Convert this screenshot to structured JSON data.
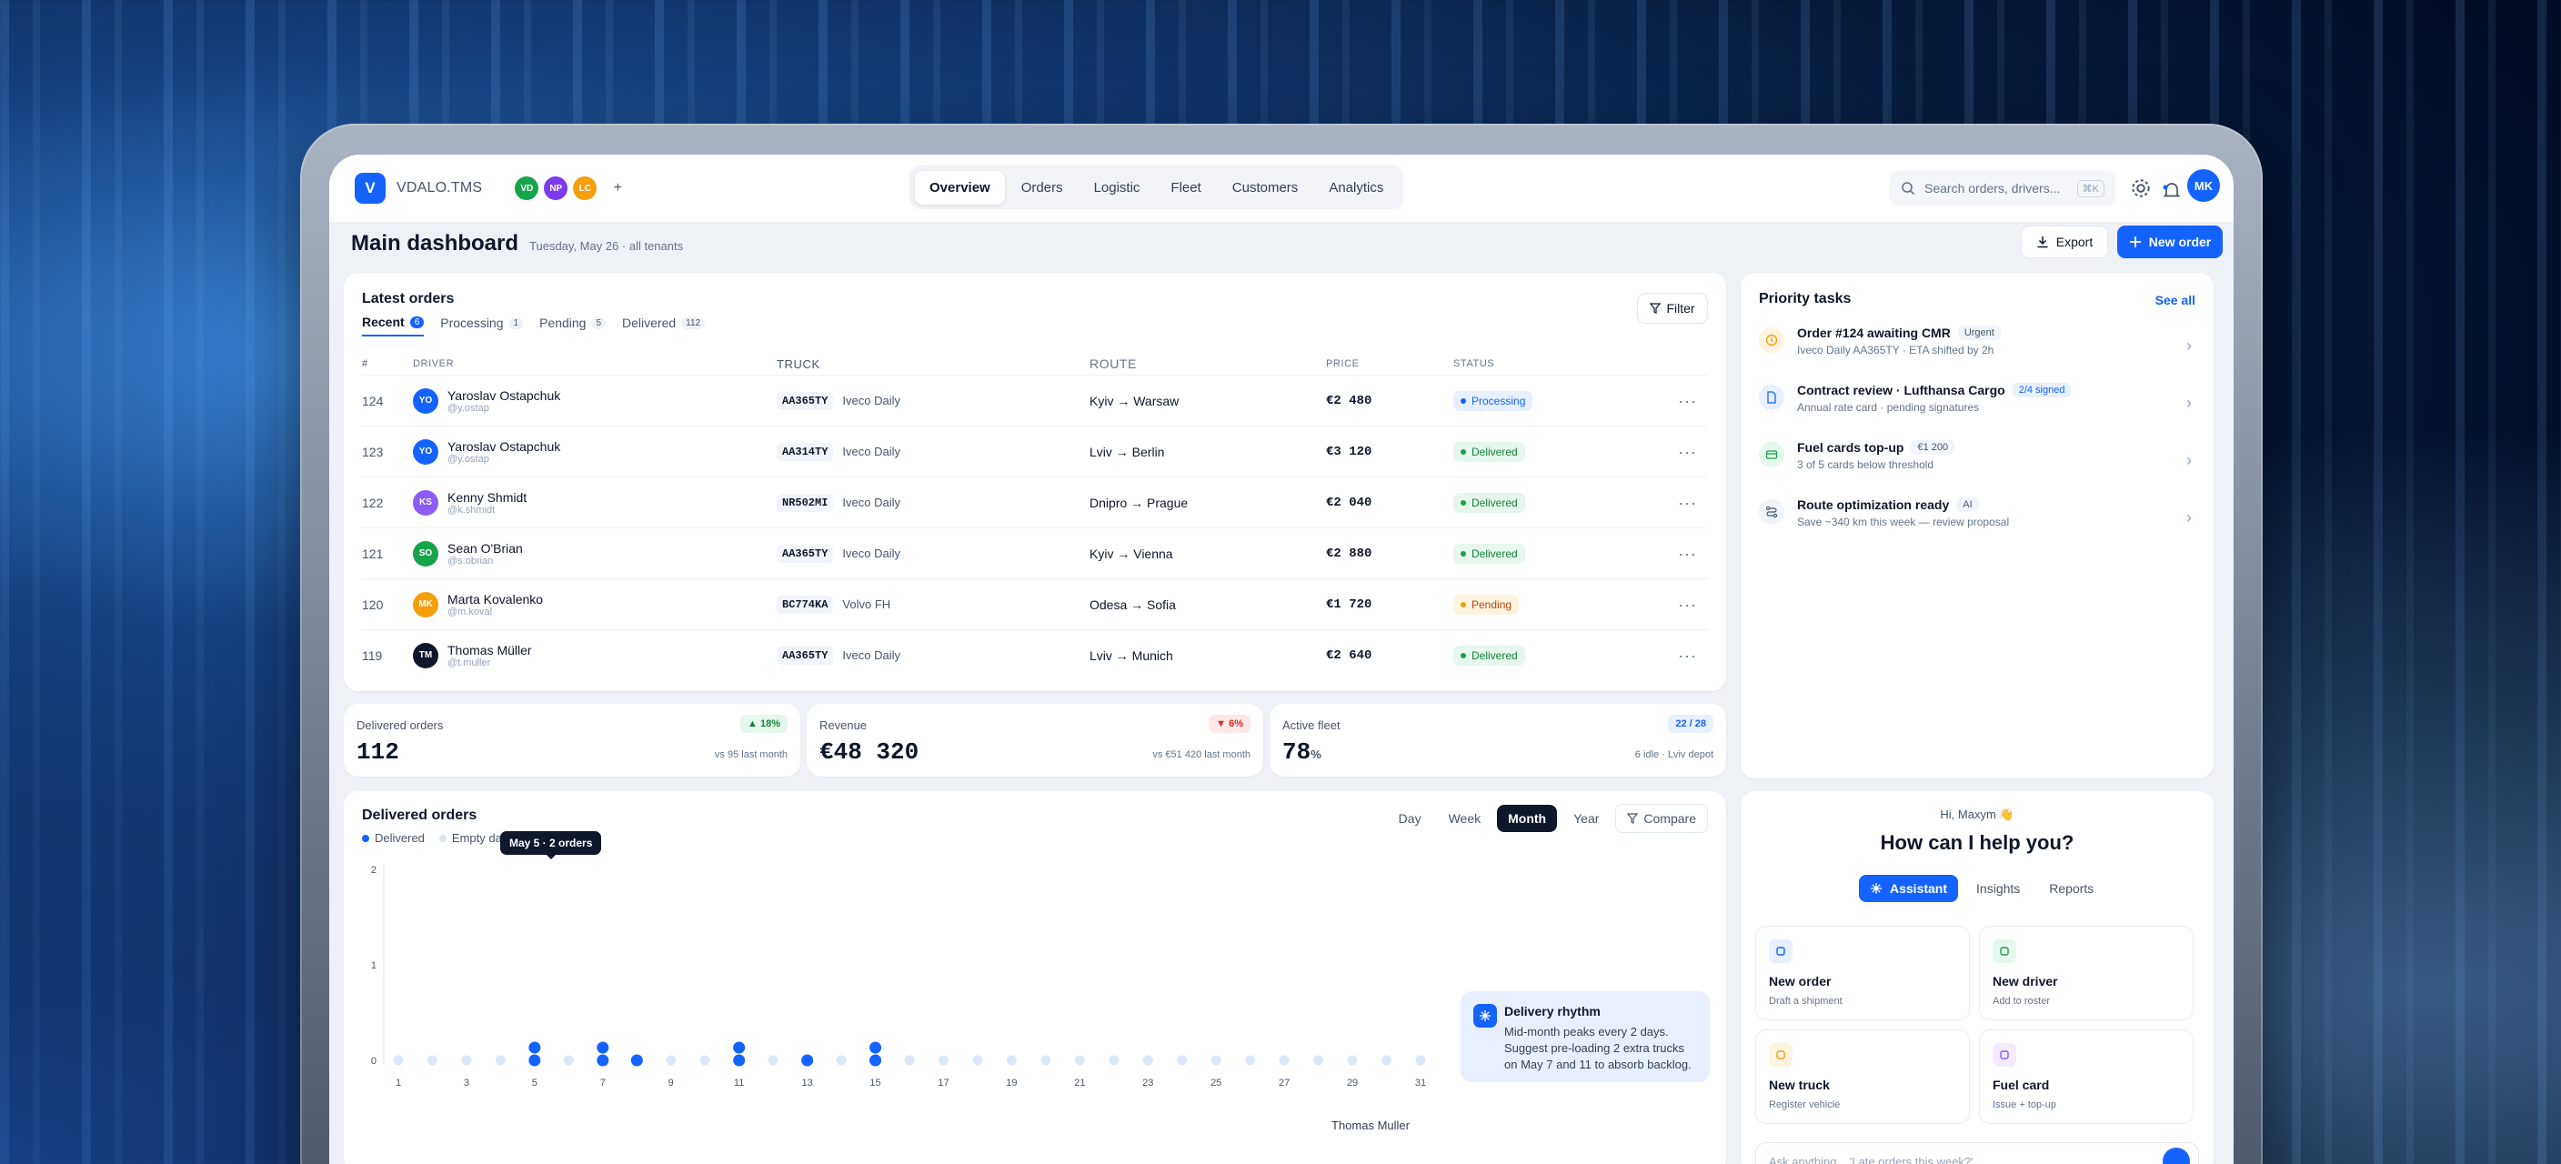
{
  "app": {
    "logo_letter": "V",
    "name": "VDALO.TMS"
  },
  "tenants": [
    {
      "initials": "VD",
      "color": "#16a34a"
    },
    {
      "initials": "NP",
      "color": "#7c3aed"
    },
    {
      "initials": "LC",
      "color": "#f59e0b"
    }
  ],
  "tenant_add": "+",
  "nav": [
    "Overview",
    "Orders",
    "Logistic",
    "Fleet",
    "Customers",
    "Analytics"
  ],
  "nav_active": "Overview",
  "search": {
    "placeholder": "Search orders, drivers...",
    "shortcut": "⌘K"
  },
  "user": {
    "initials": "MK"
  },
  "page": {
    "title": "Main dashboard",
    "subtitle": "Tuesday, May 26 · all tenants"
  },
  "actions": {
    "export": "Export",
    "new_order": "New order"
  },
  "orders": {
    "title": "Latest orders",
    "tabs": [
      {
        "label": "Recent",
        "count": "6"
      },
      {
        "label": "Processing",
        "count": "1"
      },
      {
        "label": "Pending",
        "count": "5"
      },
      {
        "label": "Delivered",
        "count": "112"
      }
    ],
    "filter": "Filter",
    "columns": [
      "#",
      "DRIVER",
      "TRUCK",
      "ROUTE",
      "PRICE",
      "STATUS"
    ],
    "rows": [
      {
        "id": "124",
        "driver": "Yaroslav Ostapchuk",
        "handle": "@y.ostap",
        "initials": "YO",
        "avatar_color": "#1463ff",
        "plate": "AA365TY",
        "truck": "Iveco Daily",
        "route": "Kyiv → Warsaw",
        "price": "€2 480",
        "status": "Processing"
      },
      {
        "id": "123",
        "driver": "Yaroslav Ostapchuk",
        "handle": "@y.ostap",
        "initials": "YO",
        "avatar_color": "#1463ff",
        "plate": "AA314TY",
        "truck": "Iveco Daily",
        "route": "Lviv → Berlin",
        "price": "€3 120",
        "status": "Delivered"
      },
      {
        "id": "122",
        "driver": "Kenny Shmidt",
        "handle": "@k.shmidt",
        "initials": "KS",
        "avatar_color": "#8b5cf6",
        "plate": "NR502MI",
        "truck": "Iveco Daily",
        "route": "Dnipro → Prague",
        "price": "€2 040",
        "status": "Delivered"
      },
      {
        "id": "121",
        "driver": "Sean O'Brian",
        "handle": "@s.obrian",
        "initials": "SO",
        "avatar_color": "#16a34a",
        "plate": "AA365TY",
        "truck": "Iveco Daily",
        "route": "Kyiv → Vienna",
        "price": "€2 880",
        "status": "Delivered"
      },
      {
        "id": "120",
        "driver": "Marta Kovalenko",
        "handle": "@m.koval",
        "initials": "MK",
        "avatar_color": "#f59e0b",
        "plate": "BC774KA",
        "truck": "Volvo FH",
        "route": "Odesa → Sofia",
        "price": "€1 720",
        "status": "Pending"
      },
      {
        "id": "119",
        "driver": "Thomas Müller",
        "handle": "@t.muller",
        "initials": "TM",
        "avatar_color": "#0f172a",
        "plate": "AA365TY",
        "truck": "Iveco Daily",
        "route": "Lviv → Munich",
        "price": "€2 640",
        "status": "Delivered"
      }
    ]
  },
  "kpis": [
    {
      "label": "Delivered orders",
      "value": "112",
      "unit": "",
      "delta": "▲ 18%",
      "delta_color": "#15803d",
      "delta_bg": "#e6f7ed",
      "sub": "vs 95 last month"
    },
    {
      "label": "Revenue",
      "value": "€48 320",
      "unit": "",
      "delta": "▼ 6%",
      "delta_color": "#dc2626",
      "delta_bg": "#fde8e8",
      "sub": "vs €51 420 last month"
    },
    {
      "label": "Active fleet",
      "value": "78",
      "unit": "%",
      "delta": "22 / 28",
      "delta_color": "#1463ff",
      "delta_bg": "#e8f0ff",
      "sub": "6 idle · Lviv depot"
    }
  ],
  "delivered_chart": {
    "title": "Delivered orders",
    "legend": [
      "Delivered",
      "Empty days"
    ],
    "periods": [
      "Day",
      "Week",
      "Month",
      "Year"
    ],
    "period_selected": "Month",
    "compare": "Compare",
    "tooltip": "May 5 · 2 orders",
    "insight_title": "Delivery rhythm",
    "insight_text": "Mid-month peaks every 2 days. Suggest pre-loading 2 extra trucks on May 7 and 11 to absorb backlog.",
    "driver_label": "Thomas Muller"
  },
  "chart_data": {
    "type": "scatter",
    "title": "Delivered orders",
    "x": [
      1,
      2,
      3,
      4,
      5,
      6,
      7,
      8,
      9,
      10,
      11,
      12,
      13,
      14,
      15,
      16,
      17,
      18,
      19,
      20,
      21,
      22,
      23,
      24,
      25,
      26,
      27,
      28,
      29,
      30,
      31
    ],
    "x_ticks": [
      1,
      3,
      5,
      7,
      9,
      11,
      13,
      15,
      17,
      19,
      21,
      23,
      25,
      27,
      29,
      31
    ],
    "series": [
      {
        "name": "Delivered",
        "values": [
          0,
          0,
          0,
          0,
          2,
          0,
          2,
          1,
          0,
          0,
          2,
          0,
          1,
          0,
          2,
          0,
          0,
          0,
          0,
          0,
          0,
          0,
          0,
          0,
          0,
          0,
          0,
          0,
          0,
          0,
          0
        ],
        "color": "#1463ff"
      }
    ],
    "ylim": [
      0,
      2
    ],
    "y_ticks": [
      0,
      1,
      2
    ],
    "empty_color": "#dbe7f7",
    "legend_position": "top-left"
  },
  "tasks": {
    "title": "Priority tasks",
    "see_all": "See all",
    "items": [
      {
        "title": "Order #124 awaiting CMR",
        "tag": "Urgent",
        "tag_bg": "#f1f5f9",
        "tag_color": "#475569",
        "sub": "Iveco Daily AA365TY · ETA shifted by 2h",
        "icon_bg": "#fff4e0",
        "icon_color": "#f59e0b",
        "icon": "clock-icon"
      },
      {
        "title": "Contract review · Lufthansa Cargo",
        "tag": "2/4 signed",
        "tag_bg": "#e8f0ff",
        "tag_color": "#1463ff",
        "sub": "Annual rate card · pending signatures",
        "icon_bg": "#e8f0ff",
        "icon_color": "#1463ff",
        "icon": "document-icon"
      },
      {
        "title": "Fuel cards top-up",
        "tag": "€1 200",
        "tag_bg": "#f1f5f9",
        "tag_color": "#475569",
        "sub": "3 of 5 cards below threshold",
        "icon_bg": "#e6f7ed",
        "icon_color": "#16a34a",
        "icon": "card-icon"
      },
      {
        "title": "Route optimization ready",
        "tag": "AI",
        "tag_bg": "#f1f5f9",
        "tag_color": "#475569",
        "sub": "Save ~340 km this week — review proposal",
        "icon_bg": "#f1f5f9",
        "icon_color": "#475569",
        "icon": "route-icon"
      }
    ]
  },
  "assistant": {
    "greeting": "Hi, Maxym 👋",
    "question": "How can I help you?",
    "tabs": [
      "Assistant",
      "Insights",
      "Reports"
    ],
    "tab_selected": "Assistant",
    "actions": [
      {
        "title": "New order",
        "sub": "Draft a shipment",
        "bg": "#e8f0ff",
        "color": "#1463ff"
      },
      {
        "title": "New driver",
        "sub": "Add to roster",
        "bg": "#e6f7ed",
        "color": "#16a34a"
      },
      {
        "title": "New truck",
        "sub": "Register vehicle",
        "bg": "#fff4e0",
        "color": "#f59e0b"
      },
      {
        "title": "Fuel card",
        "sub": "Issue + top-up",
        "bg": "#f3eafe",
        "color": "#8b5cf6"
      }
    ],
    "input_placeholder": "Ask anything... 'Late orders this week?'"
  }
}
